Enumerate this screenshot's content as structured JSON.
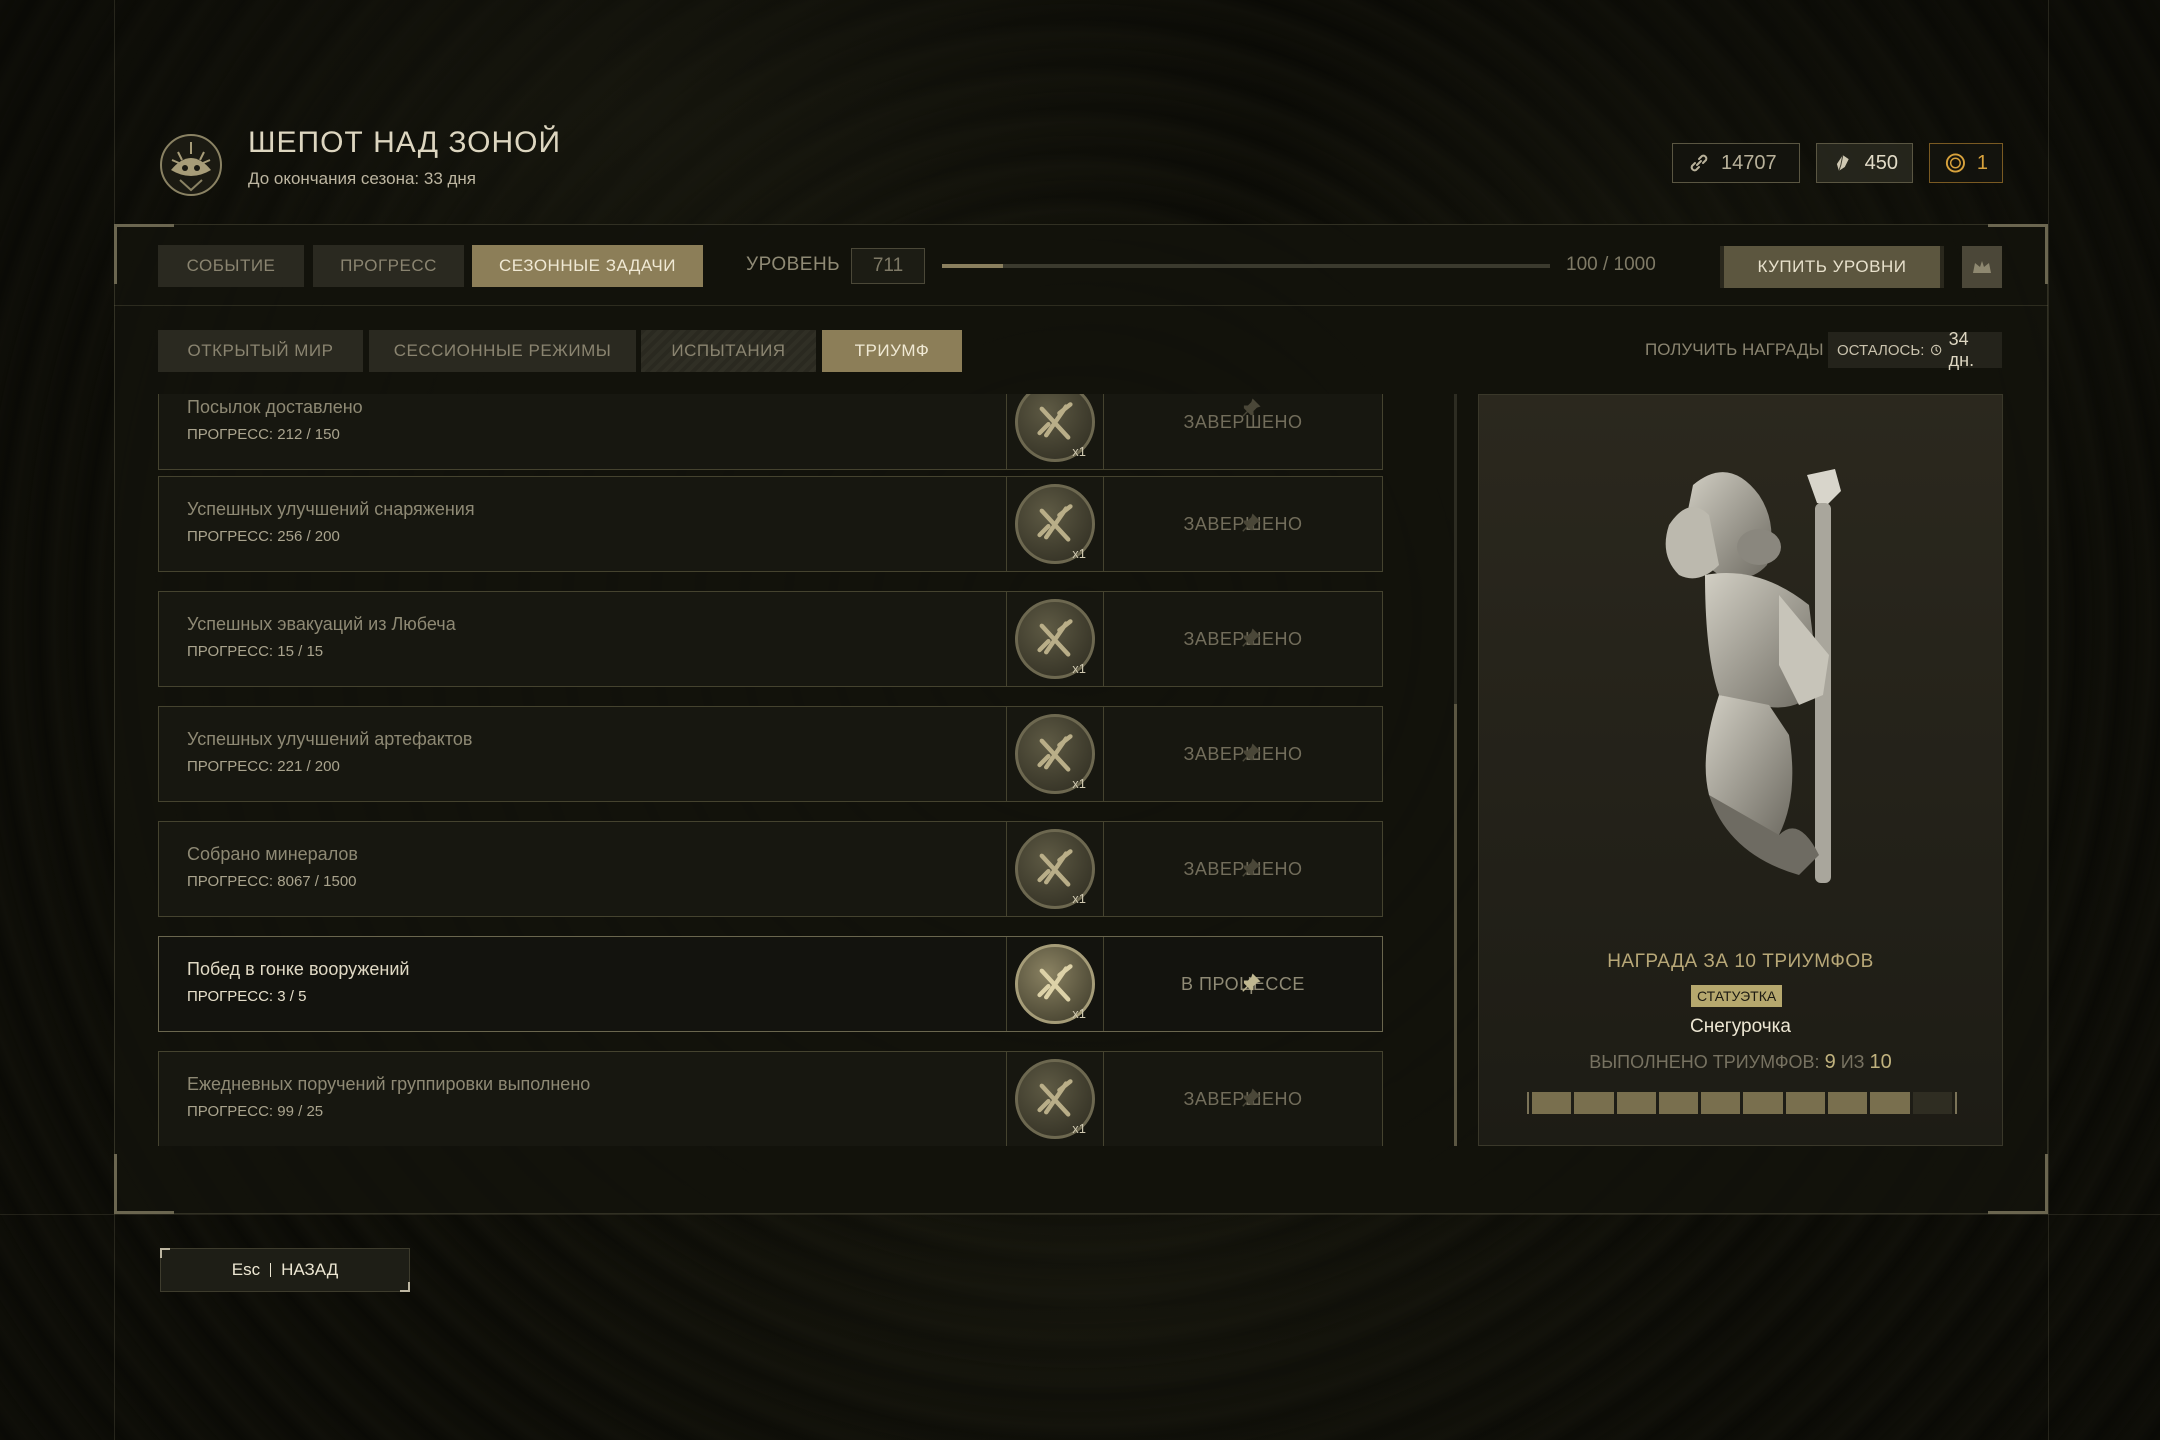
{
  "header": {
    "title": "ШЕПОТ НАД ЗОНОЙ",
    "subtitle": "До окончания сезона: 33 дня",
    "logo_icon": "season-emblem-icon"
  },
  "currencies": [
    {
      "icon": "link-icon",
      "value": "14707"
    },
    {
      "icon": "crystal-icon",
      "value": "450"
    },
    {
      "icon": "coin-icon",
      "value": "1",
      "color": "#d8a23c"
    }
  ],
  "main_tabs": [
    "СОБЫТИЕ",
    "ПРОГРЕСС",
    "СЕЗОННЫЕ ЗАДАЧИ"
  ],
  "level": {
    "label": "УРОВЕНЬ",
    "value": "711",
    "progress_text": "100 / 1000",
    "progress_fraction": 0.1
  },
  "buy_levels": "КУПИТЬ УРОВНИ",
  "sub_tabs": [
    "ОТКРЫТЫЙ МИР",
    "СЕССИОННЫЕ РЕЖИМЫ",
    "ИСПЫТАНИЯ",
    "ТРИУМФ"
  ],
  "rewards_label": "ПОЛУЧИТЬ НАГРАДЫ",
  "remaining": {
    "label": "ОСТАЛОСЬ:",
    "value": "34 дн."
  },
  "tasks": [
    {
      "name": "Посылок доставлено",
      "progress": "ПРОГРЕСС: 212 / 150",
      "status": "ЗАВЕРШЕНО",
      "reward_count": "x1"
    },
    {
      "name": "Успешных улучшений снаряжения",
      "progress": "ПРОГРЕСС: 256 / 200",
      "status": "ЗАВЕРШЕНО",
      "reward_count": "x1"
    },
    {
      "name": "Успешных эвакуаций из Любеча",
      "progress": "ПРОГРЕСС: 15 / 15",
      "status": "ЗАВЕРШЕНО",
      "reward_count": "x1"
    },
    {
      "name": "Успешных улучшений артефактов",
      "progress": "ПРОГРЕСС: 221 / 200",
      "status": "ЗАВЕРШЕНО",
      "reward_count": "x1"
    },
    {
      "name": "Собрано минералов",
      "progress": "ПРОГРЕСС: 8067 / 1500",
      "status": "ЗАВЕРШЕНО",
      "reward_count": "x1"
    },
    {
      "name": "Побед в гонке вооружений",
      "progress": "ПРОГРЕСС: 3 / 5",
      "status": "В ПРОЦЕССЕ",
      "reward_count": "x1"
    },
    {
      "name": "Ежедневных поручений группировки выполнено",
      "progress": "ПРОГРЕСС: 99 / 25",
      "status": "ЗАВЕРШЕНО",
      "reward_count": "x1"
    }
  ],
  "reward": {
    "title": "НАГРАДА ЗА 10 ТРИУМФОВ",
    "type": "СТАТУЭТКА",
    "name": "Снегурочка",
    "done_label": "ВЫПОЛНЕНО ТРИУМФОВ:",
    "done": "9",
    "of": "ИЗ",
    "total": "10"
  },
  "back": {
    "key": "Esc",
    "label": "НАЗАД"
  },
  "colors": {
    "accent": "#8c7e58",
    "gold": "#b8a878",
    "coin": "#d8a23c"
  }
}
